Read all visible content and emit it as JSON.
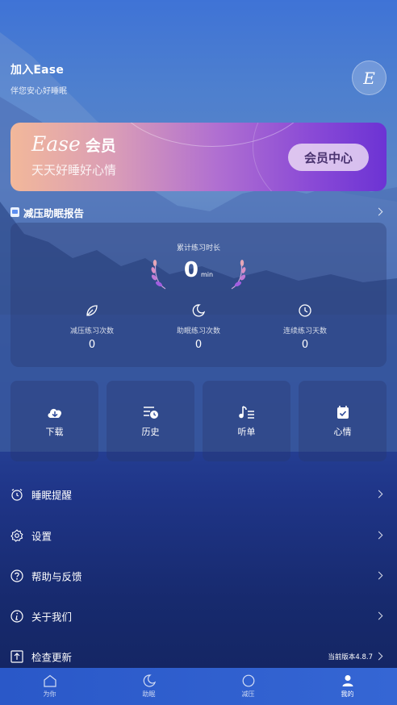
{
  "header": {
    "title": "加入Ease",
    "subtitle": "伴您安心好睡眠",
    "avatar_letter": "E"
  },
  "vip_card": {
    "brand": "Ease",
    "member_label": "会员",
    "slogan": "天天好睡好心情",
    "button_label": "会员中心"
  },
  "report": {
    "title": "减压助眠报告",
    "total_label": "累计练习时长",
    "total_value": "0",
    "total_unit": "min",
    "stats": [
      {
        "label": "减压练习次数",
        "value": "0",
        "icon": "leaf-icon"
      },
      {
        "label": "助眠练习次数",
        "value": "0",
        "icon": "moon-icon"
      },
      {
        "label": "连续练习天数",
        "value": "0",
        "icon": "clock-icon"
      }
    ]
  },
  "tiles": [
    {
      "label": "下载",
      "icon": "cloud-download-icon"
    },
    {
      "label": "历史",
      "icon": "history-icon"
    },
    {
      "label": "听单",
      "icon": "playlist-icon"
    },
    {
      "label": "心情",
      "icon": "calendar-check-icon"
    }
  ],
  "menu": [
    {
      "label": "睡眠提醒",
      "icon": "alarm-icon"
    },
    {
      "label": "设置",
      "icon": "gear-icon"
    },
    {
      "label": "帮助与反馈",
      "icon": "help-icon"
    },
    {
      "label": "关于我们",
      "icon": "info-icon"
    },
    {
      "label": "检查更新",
      "icon": "upload-icon",
      "version": "当前版本4.8.7"
    }
  ],
  "tabbar": [
    {
      "label": "为你",
      "icon": "home-icon",
      "active": false
    },
    {
      "label": "助眠",
      "icon": "moon-icon",
      "active": false
    },
    {
      "label": "减压",
      "icon": "circle-icon",
      "active": false
    },
    {
      "label": "我的",
      "icon": "user-icon",
      "active": true
    }
  ],
  "colors": {
    "vip_start": "#f2b89a",
    "vip_end": "#6c33d4",
    "tabbar": "#2f5fce",
    "laurel": "#d7a2d6"
  }
}
